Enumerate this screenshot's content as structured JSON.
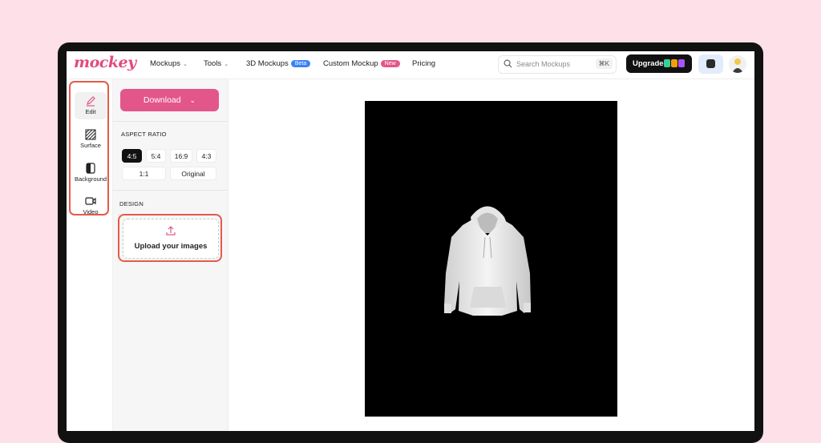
{
  "logo": "mockey",
  "nav": {
    "items": [
      {
        "label": "Mockups",
        "chevron": true
      },
      {
        "label": "Tools",
        "chevron": true
      },
      {
        "label": "3D Mockups",
        "badge": "Beta",
        "badge_color": "#3b82f6"
      },
      {
        "label": "Custom Mockup",
        "badge": "New",
        "badge_color": "#e3568a"
      },
      {
        "label": "Pricing"
      }
    ]
  },
  "search": {
    "placeholder": "Search Mockups",
    "shortcut": "⌘K"
  },
  "upgrade": {
    "label": "Upgrade"
  },
  "tools": [
    {
      "label": "Edit",
      "icon": "pencil-icon",
      "active": true
    },
    {
      "label": "Surface",
      "icon": "texture-icon"
    },
    {
      "label": "Background",
      "icon": "background-icon"
    },
    {
      "label": "Video",
      "icon": "video-icon"
    }
  ],
  "panel": {
    "download_label": "Download",
    "aspect_title": "ASPECT RATIO",
    "ratios": [
      "4:5",
      "5:4",
      "16:9",
      "4:3",
      "1:1",
      "Original"
    ],
    "active_ratio": "4:5",
    "design_title": "DESIGN",
    "upload_label": "Upload your images"
  },
  "colors": {
    "brand": "#e3568a",
    "highlight": "#e55a4a",
    "page_bg": "#fde0e8",
    "artboard": "#000000"
  }
}
